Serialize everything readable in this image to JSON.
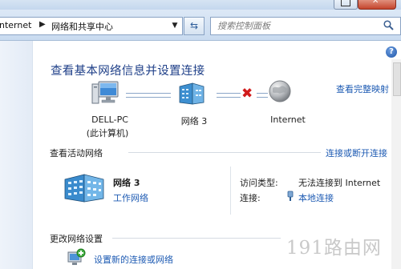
{
  "address_bar": {
    "crumbs": [
      "nternet",
      "网络和共享中心"
    ],
    "separator": "▶",
    "dropdown": "▼",
    "refresh": "⇆"
  },
  "search": {
    "placeholder": "搜索控制面板"
  },
  "help": "?",
  "page_title": "查看基本网络信息并设置连接",
  "full_map_link": "查看完整映射",
  "map": {
    "computer": {
      "name": "DELL-PC",
      "subtitle": "(此计算机)"
    },
    "network": {
      "name": "网络  3"
    },
    "internet": {
      "name": "Internet"
    },
    "status_mark": "✖"
  },
  "active_networks": {
    "heading": "查看活动网络",
    "connect_link": "连接或断开连接",
    "network_name": "网络  3",
    "network_type": "工作网络",
    "access_type_key": "访问类型:",
    "access_type_value": "无法连接到 Internet",
    "connections_key": "连接:",
    "connections_value": "本地连接"
  },
  "change_settings": {
    "heading": "更改网络设置",
    "setup_link": "设置新的连接或网络"
  },
  "watermark": {
    "num": "191",
    "text": "路由网"
  }
}
